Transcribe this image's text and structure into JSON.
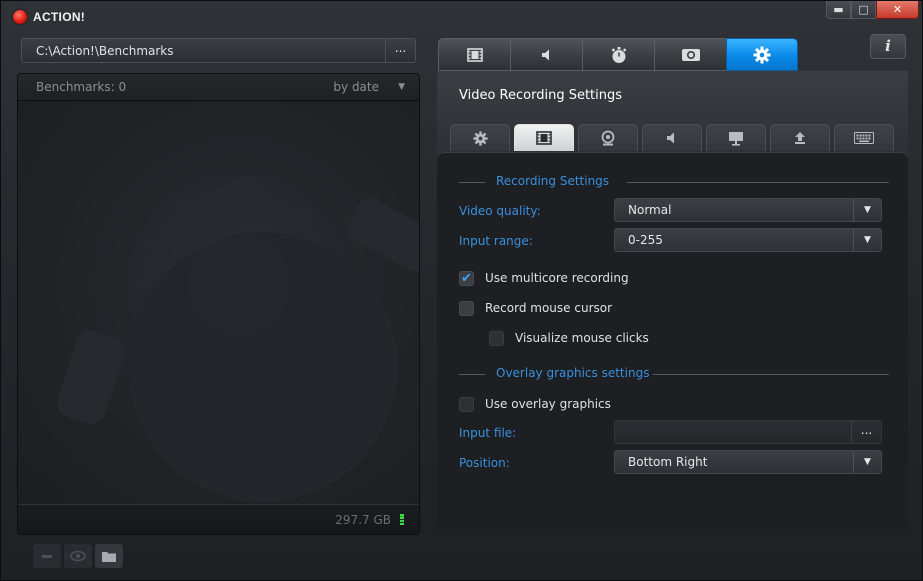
{
  "app": {
    "title": "ACTION!"
  },
  "window_controls": {
    "minimize": "▬",
    "maximize": "□",
    "close": "✕"
  },
  "path_bar": {
    "value": "C:\\Action!\\Benchmarks",
    "browse_label": "..."
  },
  "benchmarks": {
    "count_label": "Benchmarks: 0",
    "sort_label": "by date",
    "disk_space": "297.7 GB"
  },
  "bottom_buttons": [
    {
      "icon": "minus-icon"
    },
    {
      "icon": "eye-icon"
    },
    {
      "icon": "folder-icon"
    }
  ],
  "main_tabs": [
    {
      "icon": "film-icon",
      "active": false
    },
    {
      "icon": "speaker-icon",
      "active": false
    },
    {
      "icon": "stopwatch-icon",
      "active": false
    },
    {
      "icon": "camera-icon",
      "active": false
    },
    {
      "icon": "gear-icon",
      "active": true
    }
  ],
  "info_button": {
    "label": "i"
  },
  "settings": {
    "title": "Video Recording Settings",
    "sub_tabs": [
      {
        "icon": "gear-icon",
        "active": false
      },
      {
        "icon": "film-icon",
        "active": true
      },
      {
        "icon": "webcam-icon",
        "active": false
      },
      {
        "icon": "speaker-icon",
        "active": false
      },
      {
        "icon": "monitor-icon",
        "active": false
      },
      {
        "icon": "upload-icon",
        "active": false
      },
      {
        "icon": "keyboard-icon",
        "active": false
      }
    ],
    "recording_section": {
      "title": "Recording Settings"
    },
    "video_quality": {
      "label": "Video quality:",
      "value": "Normal"
    },
    "input_range": {
      "label": "Input range:",
      "value": "0-255"
    },
    "use_multicore": {
      "label": "Use multicore recording",
      "checked": true
    },
    "record_mouse": {
      "label": "Record mouse cursor",
      "checked": false
    },
    "visualize_clicks": {
      "label": "Visualize mouse clicks",
      "checked": false
    },
    "overlay_section": {
      "title": "Overlay graphics settings"
    },
    "use_overlay": {
      "label": "Use overlay graphics",
      "checked": false
    },
    "input_file": {
      "label": "Input file:",
      "value": "",
      "browse_label": "..."
    },
    "position": {
      "label": "Position:",
      "value": "Bottom Right"
    }
  },
  "colors": {
    "accent_blue": "#0a89e8",
    "label_blue": "#3a8fdc",
    "close_red": "#c6392a"
  }
}
